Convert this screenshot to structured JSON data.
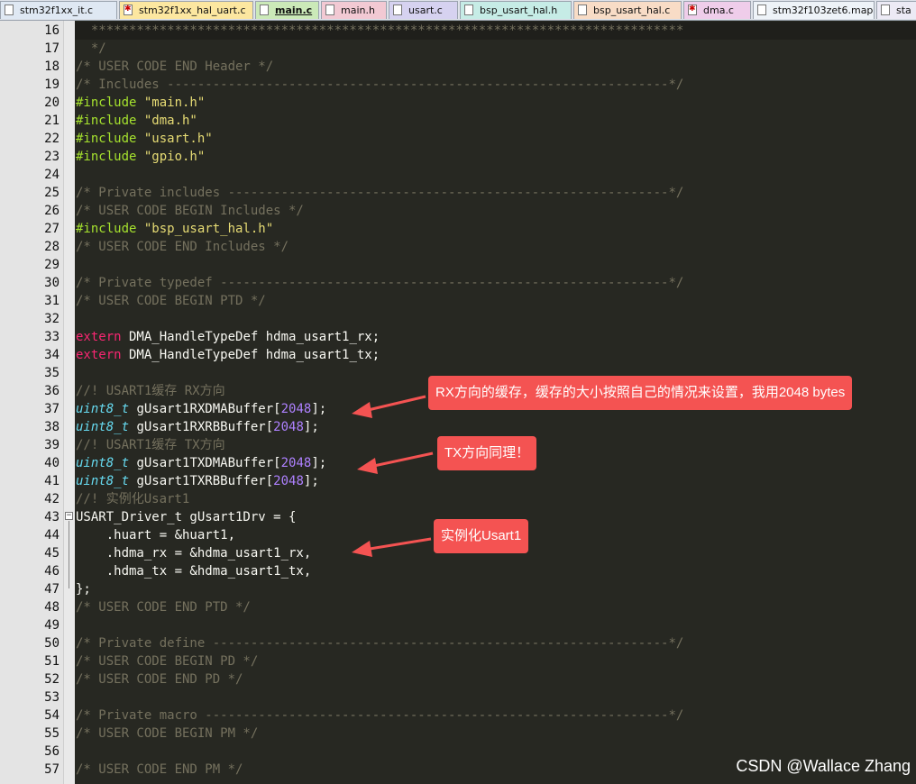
{
  "tabs": [
    {
      "label": "stm32f1xx_it.c",
      "modified": false,
      "active": false,
      "color": "#dfe8f3"
    },
    {
      "label": "stm32f1xx_hal_uart.c",
      "modified": true,
      "active": false,
      "color": "#fce7a0"
    },
    {
      "label": "main.c",
      "modified": false,
      "active": true,
      "color": "#cbe9b8"
    },
    {
      "label": "main.h",
      "modified": false,
      "active": false,
      "color": "#f2c9d3"
    },
    {
      "label": "usart.c",
      "modified": false,
      "active": false,
      "color": "#d6d2f0"
    },
    {
      "label": "bsp_usart_hal.h",
      "modified": false,
      "active": false,
      "color": "#c6ece6"
    },
    {
      "label": "bsp_usart_hal.c",
      "modified": false,
      "active": false,
      "color": "#f8dcc6"
    },
    {
      "label": "dma.c",
      "modified": true,
      "active": false,
      "color": "#efcdea"
    },
    {
      "label": "stm32f103zet6.map",
      "modified": false,
      "active": false,
      "color": "#eef3f8"
    },
    {
      "label": "sta",
      "modified": false,
      "active": false,
      "color": "#eceaf5"
    }
  ],
  "editor": {
    "lines": [
      {
        "n": "16",
        "t": "  ******************************************************************************",
        "k": "cmt"
      },
      {
        "n": "17",
        "t": "  */",
        "k": "cmt"
      },
      {
        "n": "18",
        "t": "/* USER CODE END Header */",
        "k": "cmt"
      },
      {
        "n": "19",
        "t": "/* Includes ------------------------------------------------------------------*/",
        "k": "cmt"
      },
      {
        "n": "20",
        "t": "#include \"main.h\"",
        "k": "inc"
      },
      {
        "n": "21",
        "t": "#include \"dma.h\"",
        "k": "inc"
      },
      {
        "n": "22",
        "t": "#include \"usart.h\"",
        "k": "inc"
      },
      {
        "n": "23",
        "t": "#include \"gpio.h\"",
        "k": "inc"
      },
      {
        "n": "24",
        "t": "",
        "k": "plain"
      },
      {
        "n": "25",
        "t": "/* Private includes ----------------------------------------------------------*/",
        "k": "cmt"
      },
      {
        "n": "26",
        "t": "/* USER CODE BEGIN Includes */",
        "k": "cmt"
      },
      {
        "n": "27",
        "t": "#include \"bsp_usart_hal.h\"",
        "k": "inc"
      },
      {
        "n": "28",
        "t": "/* USER CODE END Includes */",
        "k": "cmt"
      },
      {
        "n": "29",
        "t": "",
        "k": "plain"
      },
      {
        "n": "30",
        "t": "/* Private typedef -----------------------------------------------------------*/",
        "k": "cmt"
      },
      {
        "n": "31",
        "t": "/* USER CODE BEGIN PTD */",
        "k": "cmt"
      },
      {
        "n": "32",
        "t": "",
        "k": "plain"
      },
      {
        "n": "33",
        "t": "extern DMA_HandleTypeDef hdma_usart1_rx;",
        "k": "ext"
      },
      {
        "n": "34",
        "t": "extern DMA_HandleTypeDef hdma_usart1_tx;",
        "k": "ext"
      },
      {
        "n": "35",
        "t": "",
        "k": "plain"
      },
      {
        "n": "36",
        "t": "//! USART1缓存 RX方向",
        "k": "cmt"
      },
      {
        "n": "37",
        "t": "uint8_t gUsart1RXDMABuffer[2048];",
        "k": "arr"
      },
      {
        "n": "38",
        "t": "uint8_t gUsart1RXRBBuffer[2048];",
        "k": "arr"
      },
      {
        "n": "39",
        "t": "//! USART1缓存 TX方向",
        "k": "cmt"
      },
      {
        "n": "40",
        "t": "uint8_t gUsart1TXDMABuffer[2048];",
        "k": "arr"
      },
      {
        "n": "41",
        "t": "uint8_t gUsart1TXRBBuffer[2048];",
        "k": "arr"
      },
      {
        "n": "42",
        "t": "//! 实例化Usart1",
        "k": "cmt"
      },
      {
        "n": "43",
        "t": "USART_Driver_t gUsart1Drv = {",
        "k": "plain"
      },
      {
        "n": "44",
        "t": "    .huart = &huart1,",
        "k": "plain"
      },
      {
        "n": "45",
        "t": "    .hdma_rx = &hdma_usart1_rx,",
        "k": "plain"
      },
      {
        "n": "46",
        "t": "    .hdma_tx = &hdma_usart1_tx,",
        "k": "plain"
      },
      {
        "n": "47",
        "t": "};",
        "k": "plain"
      },
      {
        "n": "48",
        "t": "/* USER CODE END PTD */",
        "k": "cmt"
      },
      {
        "n": "49",
        "t": "",
        "k": "plain"
      },
      {
        "n": "50",
        "t": "/* Private define ------------------------------------------------------------*/",
        "k": "cmt"
      },
      {
        "n": "51",
        "t": "/* USER CODE BEGIN PD */",
        "k": "cmt"
      },
      {
        "n": "52",
        "t": "/* USER CODE END PD */",
        "k": "cmt"
      },
      {
        "n": "53",
        "t": "",
        "k": "plain"
      },
      {
        "n": "54",
        "t": "/* Private macro -------------------------------------------------------------*/",
        "k": "cmt"
      },
      {
        "n": "55",
        "t": "/* USER CODE BEGIN PM */",
        "k": "cmt"
      },
      {
        "n": "56",
        "t": "",
        "k": "plain"
      },
      {
        "n": "57",
        "t": "/* USER CODE END PM */",
        "k": "cmt"
      }
    ],
    "fold_marker": "−"
  },
  "annotations": [
    {
      "text": "RX方向的缓存，缓存的大小按照自己的情况来设置，我用2048 bytes",
      "color": "#f45352"
    },
    {
      "text": "TX方向同理！",
      "color": "#f45352"
    },
    {
      "text": "实例化Usart1",
      "color": "#f45352"
    }
  ],
  "watermark": "CSDN @Wallace Zhang",
  "colors": {
    "editor_bg": "#272822",
    "comment": "#75715e",
    "preprocessor": "#a6e22e",
    "string": "#e6db74",
    "keyword": "#f92672",
    "type": "#66d9ef",
    "number": "#ae81ff"
  }
}
